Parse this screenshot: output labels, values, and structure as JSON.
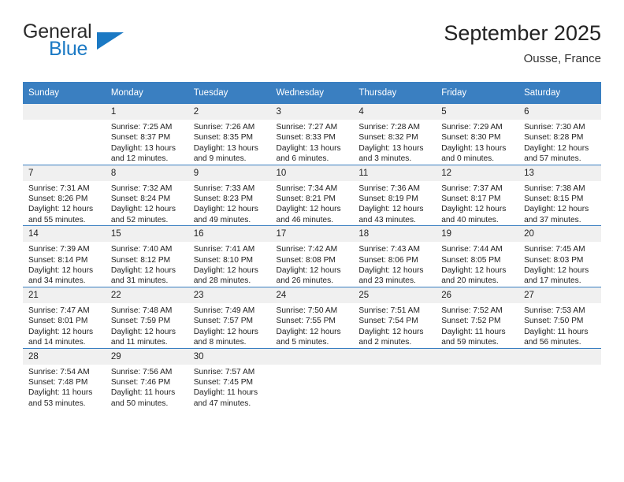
{
  "logo": {
    "primary_text": "General",
    "secondary_text": "Blue",
    "accent_color": "#1b79c4",
    "triangle_icon": "triangle-icon"
  },
  "header": {
    "title": "September 2025",
    "subtitle": "Ousse, France"
  },
  "theme": {
    "header_bg": "#3a7fc1",
    "daynum_bg": "#f0f0f0",
    "text_color": "#222222"
  },
  "weekday_headers": [
    "Sunday",
    "Monday",
    "Tuesday",
    "Wednesday",
    "Thursday",
    "Friday",
    "Saturday"
  ],
  "weeks": [
    [
      {
        "day": "",
        "blank": true,
        "sunrise": "",
        "sunset": "",
        "daylight_line1": "",
        "daylight_line2": ""
      },
      {
        "day": "1",
        "blank": false,
        "sunrise": "Sunrise: 7:25 AM",
        "sunset": "Sunset: 8:37 PM",
        "daylight_line1": "Daylight: 13 hours",
        "daylight_line2": "and 12 minutes."
      },
      {
        "day": "2",
        "blank": false,
        "sunrise": "Sunrise: 7:26 AM",
        "sunset": "Sunset: 8:35 PM",
        "daylight_line1": "Daylight: 13 hours",
        "daylight_line2": "and 9 minutes."
      },
      {
        "day": "3",
        "blank": false,
        "sunrise": "Sunrise: 7:27 AM",
        "sunset": "Sunset: 8:33 PM",
        "daylight_line1": "Daylight: 13 hours",
        "daylight_line2": "and 6 minutes."
      },
      {
        "day": "4",
        "blank": false,
        "sunrise": "Sunrise: 7:28 AM",
        "sunset": "Sunset: 8:32 PM",
        "daylight_line1": "Daylight: 13 hours",
        "daylight_line2": "and 3 minutes."
      },
      {
        "day": "5",
        "blank": false,
        "sunrise": "Sunrise: 7:29 AM",
        "sunset": "Sunset: 8:30 PM",
        "daylight_line1": "Daylight: 13 hours",
        "daylight_line2": "and 0 minutes."
      },
      {
        "day": "6",
        "blank": false,
        "sunrise": "Sunrise: 7:30 AM",
        "sunset": "Sunset: 8:28 PM",
        "daylight_line1": "Daylight: 12 hours",
        "daylight_line2": "and 57 minutes."
      }
    ],
    [
      {
        "day": "7",
        "blank": false,
        "sunrise": "Sunrise: 7:31 AM",
        "sunset": "Sunset: 8:26 PM",
        "daylight_line1": "Daylight: 12 hours",
        "daylight_line2": "and 55 minutes."
      },
      {
        "day": "8",
        "blank": false,
        "sunrise": "Sunrise: 7:32 AM",
        "sunset": "Sunset: 8:24 PM",
        "daylight_line1": "Daylight: 12 hours",
        "daylight_line2": "and 52 minutes."
      },
      {
        "day": "9",
        "blank": false,
        "sunrise": "Sunrise: 7:33 AM",
        "sunset": "Sunset: 8:23 PM",
        "daylight_line1": "Daylight: 12 hours",
        "daylight_line2": "and 49 minutes."
      },
      {
        "day": "10",
        "blank": false,
        "sunrise": "Sunrise: 7:34 AM",
        "sunset": "Sunset: 8:21 PM",
        "daylight_line1": "Daylight: 12 hours",
        "daylight_line2": "and 46 minutes."
      },
      {
        "day": "11",
        "blank": false,
        "sunrise": "Sunrise: 7:36 AM",
        "sunset": "Sunset: 8:19 PM",
        "daylight_line1": "Daylight: 12 hours",
        "daylight_line2": "and 43 minutes."
      },
      {
        "day": "12",
        "blank": false,
        "sunrise": "Sunrise: 7:37 AM",
        "sunset": "Sunset: 8:17 PM",
        "daylight_line1": "Daylight: 12 hours",
        "daylight_line2": "and 40 minutes."
      },
      {
        "day": "13",
        "blank": false,
        "sunrise": "Sunrise: 7:38 AM",
        "sunset": "Sunset: 8:15 PM",
        "daylight_line1": "Daylight: 12 hours",
        "daylight_line2": "and 37 minutes."
      }
    ],
    [
      {
        "day": "14",
        "blank": false,
        "sunrise": "Sunrise: 7:39 AM",
        "sunset": "Sunset: 8:14 PM",
        "daylight_line1": "Daylight: 12 hours",
        "daylight_line2": "and 34 minutes."
      },
      {
        "day": "15",
        "blank": false,
        "sunrise": "Sunrise: 7:40 AM",
        "sunset": "Sunset: 8:12 PM",
        "daylight_line1": "Daylight: 12 hours",
        "daylight_line2": "and 31 minutes."
      },
      {
        "day": "16",
        "blank": false,
        "sunrise": "Sunrise: 7:41 AM",
        "sunset": "Sunset: 8:10 PM",
        "daylight_line1": "Daylight: 12 hours",
        "daylight_line2": "and 28 minutes."
      },
      {
        "day": "17",
        "blank": false,
        "sunrise": "Sunrise: 7:42 AM",
        "sunset": "Sunset: 8:08 PM",
        "daylight_line1": "Daylight: 12 hours",
        "daylight_line2": "and 26 minutes."
      },
      {
        "day": "18",
        "blank": false,
        "sunrise": "Sunrise: 7:43 AM",
        "sunset": "Sunset: 8:06 PM",
        "daylight_line1": "Daylight: 12 hours",
        "daylight_line2": "and 23 minutes."
      },
      {
        "day": "19",
        "blank": false,
        "sunrise": "Sunrise: 7:44 AM",
        "sunset": "Sunset: 8:05 PM",
        "daylight_line1": "Daylight: 12 hours",
        "daylight_line2": "and 20 minutes."
      },
      {
        "day": "20",
        "blank": false,
        "sunrise": "Sunrise: 7:45 AM",
        "sunset": "Sunset: 8:03 PM",
        "daylight_line1": "Daylight: 12 hours",
        "daylight_line2": "and 17 minutes."
      }
    ],
    [
      {
        "day": "21",
        "blank": false,
        "sunrise": "Sunrise: 7:47 AM",
        "sunset": "Sunset: 8:01 PM",
        "daylight_line1": "Daylight: 12 hours",
        "daylight_line2": "and 14 minutes."
      },
      {
        "day": "22",
        "blank": false,
        "sunrise": "Sunrise: 7:48 AM",
        "sunset": "Sunset: 7:59 PM",
        "daylight_line1": "Daylight: 12 hours",
        "daylight_line2": "and 11 minutes."
      },
      {
        "day": "23",
        "blank": false,
        "sunrise": "Sunrise: 7:49 AM",
        "sunset": "Sunset: 7:57 PM",
        "daylight_line1": "Daylight: 12 hours",
        "daylight_line2": "and 8 minutes."
      },
      {
        "day": "24",
        "blank": false,
        "sunrise": "Sunrise: 7:50 AM",
        "sunset": "Sunset: 7:55 PM",
        "daylight_line1": "Daylight: 12 hours",
        "daylight_line2": "and 5 minutes."
      },
      {
        "day": "25",
        "blank": false,
        "sunrise": "Sunrise: 7:51 AM",
        "sunset": "Sunset: 7:54 PM",
        "daylight_line1": "Daylight: 12 hours",
        "daylight_line2": "and 2 minutes."
      },
      {
        "day": "26",
        "blank": false,
        "sunrise": "Sunrise: 7:52 AM",
        "sunset": "Sunset: 7:52 PM",
        "daylight_line1": "Daylight: 11 hours",
        "daylight_line2": "and 59 minutes."
      },
      {
        "day": "27",
        "blank": false,
        "sunrise": "Sunrise: 7:53 AM",
        "sunset": "Sunset: 7:50 PM",
        "daylight_line1": "Daylight: 11 hours",
        "daylight_line2": "and 56 minutes."
      }
    ],
    [
      {
        "day": "28",
        "blank": false,
        "sunrise": "Sunrise: 7:54 AM",
        "sunset": "Sunset: 7:48 PM",
        "daylight_line1": "Daylight: 11 hours",
        "daylight_line2": "and 53 minutes."
      },
      {
        "day": "29",
        "blank": false,
        "sunrise": "Sunrise: 7:56 AM",
        "sunset": "Sunset: 7:46 PM",
        "daylight_line1": "Daylight: 11 hours",
        "daylight_line2": "and 50 minutes."
      },
      {
        "day": "30",
        "blank": false,
        "sunrise": "Sunrise: 7:57 AM",
        "sunset": "Sunset: 7:45 PM",
        "daylight_line1": "Daylight: 11 hours",
        "daylight_line2": "and 47 minutes."
      },
      {
        "day": "",
        "blank": true,
        "sunrise": "",
        "sunset": "",
        "daylight_line1": "",
        "daylight_line2": ""
      },
      {
        "day": "",
        "blank": true,
        "sunrise": "",
        "sunset": "",
        "daylight_line1": "",
        "daylight_line2": ""
      },
      {
        "day": "",
        "blank": true,
        "sunrise": "",
        "sunset": "",
        "daylight_line1": "",
        "daylight_line2": ""
      },
      {
        "day": "",
        "blank": true,
        "sunrise": "",
        "sunset": "",
        "daylight_line1": "",
        "daylight_line2": ""
      }
    ]
  ]
}
